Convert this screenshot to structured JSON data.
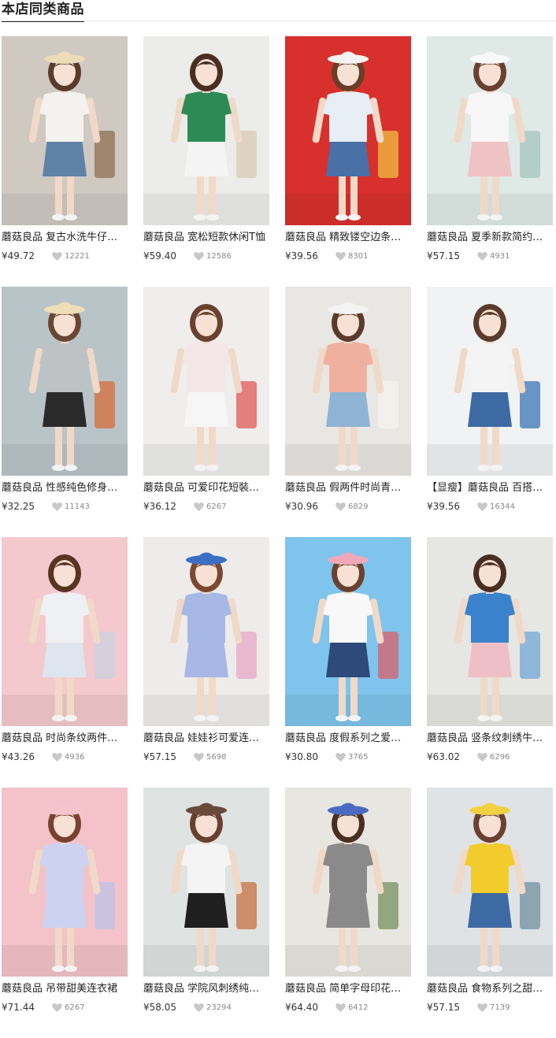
{
  "header": {
    "title": "本店同类商品"
  },
  "colors": {
    "heart": "#c8c8c8",
    "title_underline": "#222222"
  },
  "products": [
    {
      "title": "蘑菇良品 复古水洗牛仔半身裙",
      "price": "¥49.72",
      "likes": "12221",
      "photo": {
        "bg": "#cfc9c2",
        "top": "#f4f2ee",
        "bottom": "#5f82a8",
        "hat": "#eedcb8",
        "hair": "#5a3a2a",
        "accent": "#8a6a4a"
      }
    },
    {
      "title": "蘑菇良品 宽松短款休闲T恤",
      "price": "¥59.40",
      "likes": "12586",
      "photo": {
        "bg": "#ececea",
        "top": "#2e8a55",
        "bottom": "#f4f4f4",
        "hat": "",
        "hair": "#4a2e22",
        "accent": "#d9c9b0"
      }
    },
    {
      "title": "蘑菇良品 精致镂空边条纹上衣",
      "price": "¥39.56",
      "likes": "8301",
      "photo": {
        "bg": "#d8302c",
        "top": "#e8eef6",
        "bottom": "#4a70a8",
        "hat": "#f2f2f2",
        "hair": "#6a3e26",
        "accent": "#f2c840"
      }
    },
    {
      "title": "蘑菇良品 夏季新款简约背带裙",
      "price": "¥57.15",
      "likes": "4931",
      "photo": {
        "bg": "#dfe9e6",
        "top": "#f6f6f6",
        "bottom": "#efc3c3",
        "hat": "#f8f8f8",
        "hair": "#6a4030",
        "accent": "#9fc2b8"
      }
    },
    {
      "title": "蘑菇良品 性感纯色修身吊带背心",
      "price": "¥32.25",
      "likes": "11143",
      "photo": {
        "bg": "#b9c4c9",
        "top": "#bfc2c2",
        "bottom": "#2a2a2a",
        "hat": "#efdfb8",
        "hair": "#6a4632",
        "accent": "#d7682e"
      }
    },
    {
      "title": "蘑菇良品 可爱印花短裝吊带",
      "price": "¥36.12",
      "likes": "6267",
      "photo": {
        "bg": "#efeeec",
        "top": "#f3e6e6",
        "bottom": "#f6f6f6",
        "hat": "",
        "hair": "#6a4030",
        "accent": "#e05050"
      }
    },
    {
      "title": "蘑菇良品 假两件时尚青春T恤",
      "price": "¥30.96",
      "likes": "6829",
      "photo": {
        "bg": "#e9e7e3",
        "top": "#f0b0a0",
        "bottom": "#8fb4d6",
        "hat": "#f4f4f4",
        "hair": "#5a3a2a",
        "accent": "#f6f4ee"
      }
    },
    {
      "title": "【显瘦】蘑菇良品 百搭牛仔短裤",
      "price": "¥39.56",
      "likes": "16344",
      "photo": {
        "bg": "#f0f2f3",
        "top": "#f4f4f4",
        "bottom": "#3d6aa2",
        "hat": "",
        "hair": "#5a3a2a",
        "accent": "#2f6db2"
      }
    },
    {
      "title": "蘑菇良品 时尚条纹两件套连衣裙",
      "price": "¥43.26",
      "likes": "4936",
      "photo": {
        "bg": "#f4c9cd",
        "top": "#eef0f4",
        "bottom": "#dfe5ee",
        "hat": "",
        "hair": "#5a3422",
        "accent": "#c8d2e2"
      }
    },
    {
      "title": "蘑菇良品 娃娃衫可爱连衣裙",
      "price": "¥57.15",
      "likes": "5698",
      "photo": {
        "bg": "#eeecea",
        "top": "#a7b7e6",
        "bottom": "#a7b7e6",
        "hat": "#3a6fc4",
        "hair": "#7a4a30",
        "accent": "#e7a4c4"
      }
    },
    {
      "title": "蘑菇良品 度假系列之爱心T恤",
      "price": "¥30.80",
      "likes": "3765",
      "photo": {
        "bg": "#7ec4ec",
        "top": "#f8f8f8",
        "bottom": "#2e4a7a",
        "hat": "#f0a7b7",
        "hair": "#6a4030",
        "accent": "#e05a60"
      }
    },
    {
      "title": "蘑菇良品 竖条纹刺绣牛仔半身裙",
      "price": "¥63.02",
      "likes": "6296",
      "photo": {
        "bg": "#e6e6e2",
        "top": "#3a82cc",
        "bottom": "#efbfc7",
        "hat": "",
        "hair": "#4a2e22",
        "accent": "#6aa2d6"
      }
    },
    {
      "title": "蘑菇良品 吊带甜美连衣裙",
      "price": "¥71.44",
      "likes": "6267",
      "photo": {
        "bg": "#f3c3c9",
        "top": "#cdd2f0",
        "bottom": "#cdd2f0",
        "hat": "#f6c2cc",
        "hair": "#7a4030",
        "accent": "#b9c2ea"
      }
    },
    {
      "title": "蘑菇良品 学院风刺绣纯色上衣",
      "price": "¥58.05",
      "likes": "23294",
      "photo": {
        "bg": "#dfe4e2",
        "top": "#f4f4f4",
        "bottom": "#1f1f1f",
        "hat": "#6a4a3a",
        "hair": "#6a4030",
        "accent": "#c46a3a"
      }
    },
    {
      "title": "蘑菇良品 简单字母印花连衣裙",
      "price": "¥64.40",
      "likes": "6412",
      "photo": {
        "bg": "#e8e6e0",
        "top": "#8a8a8a",
        "bottom": "#8a8a8a",
        "hat": "#4a6ac2",
        "hair": "#4a2e22",
        "accent": "#6f8a5a"
      }
    },
    {
      "title": "蘑菇良品 食物系列之甜品T恤",
      "price": "¥57.15",
      "likes": "7139",
      "photo": {
        "bg": "#dfe3e6",
        "top": "#f2cc2c",
        "bottom": "#3d6aa2",
        "hat": "#f2d040",
        "hair": "#6a4030",
        "accent": "#6a8a9a"
      }
    }
  ]
}
